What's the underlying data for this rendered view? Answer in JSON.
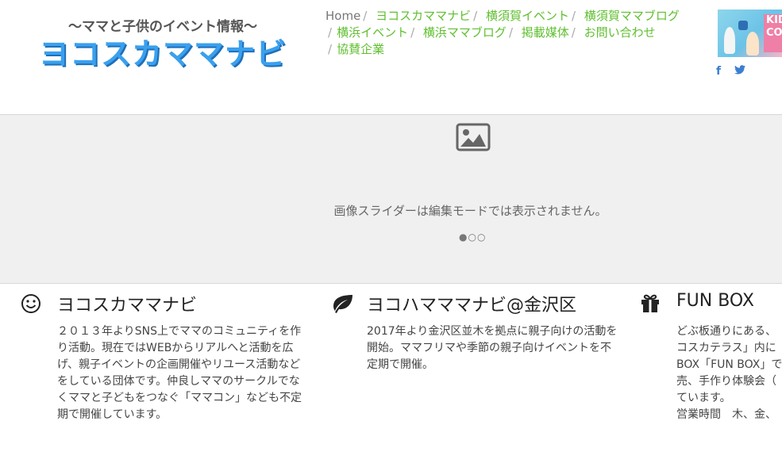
{
  "logo": {
    "subtitle": "〜ママと子供のイベント情報〜",
    "title": "ヨコスカママナビ"
  },
  "nav": {
    "items": [
      "Home",
      "ヨコスカママナビ",
      "横須賀イベント",
      "横須賀ママブログ",
      "横浜イベント",
      "横浜ママブログ",
      "掲載媒体",
      "お問い合わせ",
      "協賛企業"
    ],
    "separator": "/"
  },
  "banner": {
    "text": "KID CO"
  },
  "social": {
    "facebook": "f",
    "twitter": "twitter-icon"
  },
  "slider": {
    "message": "画像スライダーは編集モードでは表示されません。",
    "dots": "●○○"
  },
  "features": [
    {
      "icon": "smile-icon",
      "title": "ヨコスカママナビ",
      "text": "２０１３年よりSNS上でママのコミュニティを作り活動。現在ではWEBからリアルへと活動を広げ、親子イベントの企画開催やリユース活動などをしている団体です。仲良しママのサークルでなくママと子どもをつなぐ「ママコン」なども不定期で開催しています。"
    },
    {
      "icon": "leaf-icon",
      "title": "ヨコハマママナビ@金沢区",
      "text": "2017年より金沢区並木を拠点に親子向けの活動を開始。ママフリマや季節の親子向けイベントを不定期で開催。"
    },
    {
      "icon": "gift-icon",
      "title": "FUN BOX",
      "text": "どぶ板通りにある、\nコスカテラス」内に\nBOX「FUN BOX」で\n売、手作り体験会（\nています。\n営業時間　木、金、"
    }
  ]
}
